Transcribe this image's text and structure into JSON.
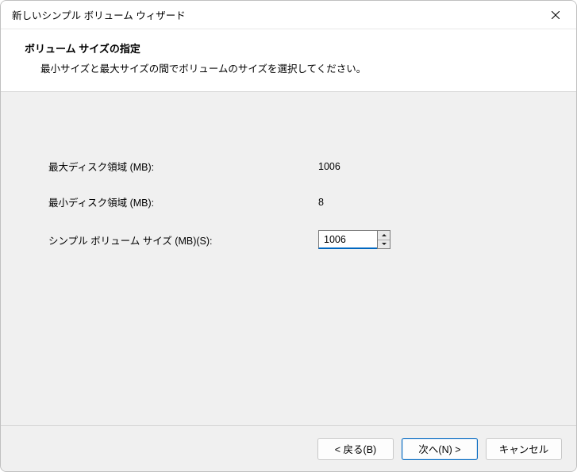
{
  "window": {
    "title": "新しいシンプル ボリューム ウィザード"
  },
  "header": {
    "heading": "ボリューム サイズの指定",
    "sub": "最小サイズと最大サイズの間でボリュームのサイズを選択してください。"
  },
  "fields": {
    "max_label": "最大ディスク領域 (MB):",
    "max_value": "1006",
    "min_label": "最小ディスク領域 (MB):",
    "min_value": "8",
    "size_label": "シンプル ボリューム サイズ (MB)(S):",
    "size_value": "1006"
  },
  "footer": {
    "back": "< 戻る(B)",
    "next": "次へ(N) >",
    "cancel": "キャンセル"
  }
}
